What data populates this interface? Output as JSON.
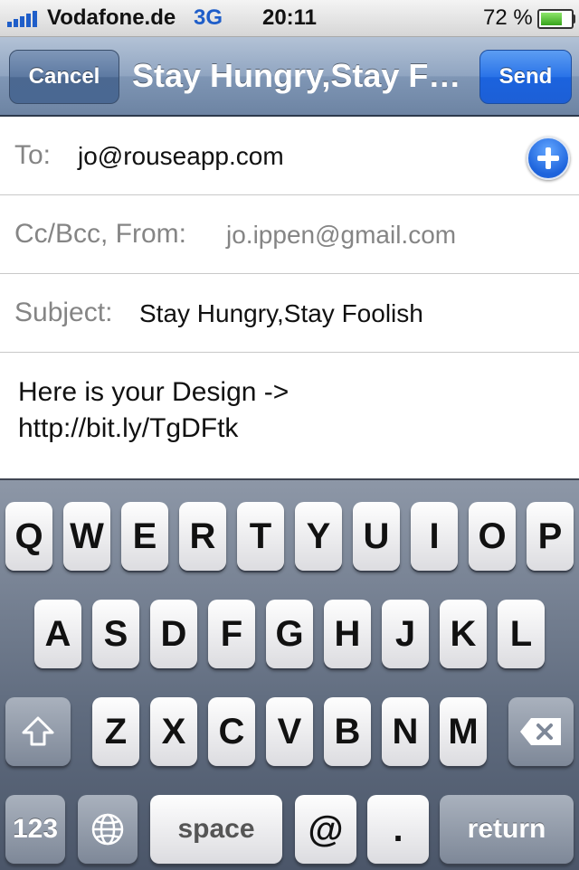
{
  "status_bar": {
    "carrier": "Vodafone.de",
    "network": "3G",
    "time": "20:11",
    "battery_percent": "72 %",
    "battery_level": 0.72
  },
  "nav": {
    "cancel_label": "Cancel",
    "title": "Stay Hungry,Stay Foolish",
    "send_label": "Send"
  },
  "fields": {
    "to_label": "To:",
    "to_value": "jo@rouseapp.com",
    "ccbcc_label": "Cc/Bcc, From:",
    "from_value": "jo.ippen@gmail.com",
    "subject_label": "Subject:",
    "subject_value": "Stay Hungry,Stay Foolish"
  },
  "body": {
    "lines": [
      "Here is your Design ->",
      "http://bit.ly/TgDFtk"
    ]
  },
  "keyboard": {
    "row1": [
      "Q",
      "W",
      "E",
      "R",
      "T",
      "Y",
      "U",
      "I",
      "O",
      "P"
    ],
    "row2": [
      "A",
      "S",
      "D",
      "F",
      "G",
      "H",
      "J",
      "K",
      "L"
    ],
    "row3": [
      "Z",
      "X",
      "C",
      "V",
      "B",
      "N",
      "M"
    ],
    "numbers_label": "123",
    "space_label": "space",
    "at_label": "@",
    "dot_label": ".",
    "return_label": "return",
    "shift_icon": "shift-icon",
    "globe_icon": "globe-icon",
    "backspace_icon": "backspace-icon"
  }
}
